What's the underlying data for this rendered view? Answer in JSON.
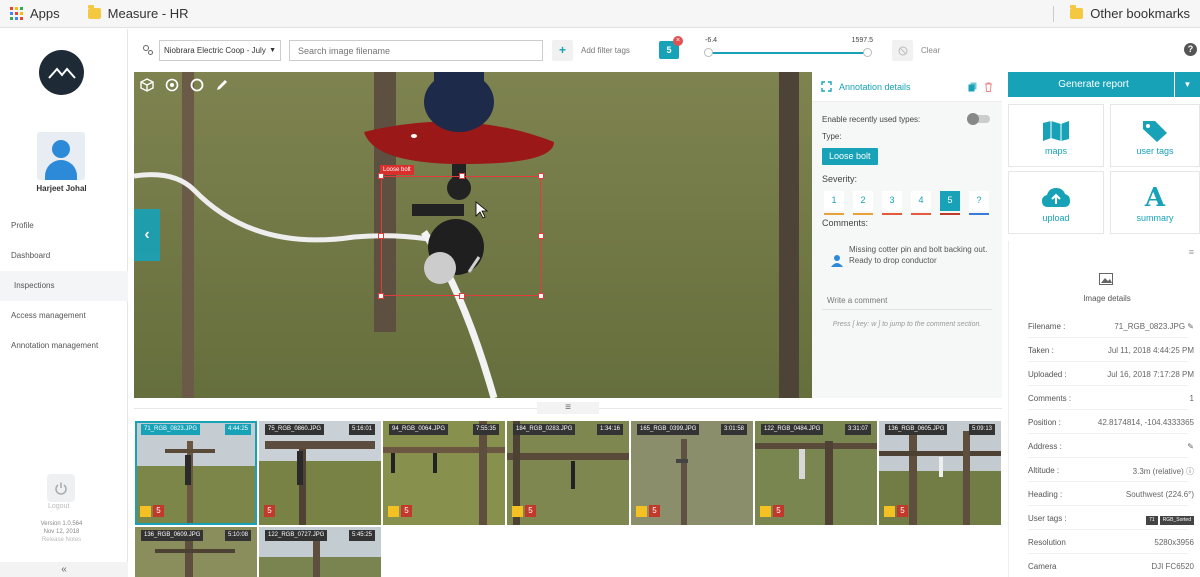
{
  "bookmarks": {
    "apps": "Apps",
    "folder1": "Measure - HR",
    "other": "Other bookmarks"
  },
  "sidebar": {
    "user_name": "Harjeet Johal",
    "nav": [
      {
        "label": "Profile"
      },
      {
        "label": "Dashboard"
      },
      {
        "label": "Inspections"
      },
      {
        "label": "Access management"
      },
      {
        "label": "Annotation management"
      }
    ],
    "logout": "Logout",
    "version": "Version 1.0.564",
    "version_date": "Nov 12, 2018",
    "release_notes": "Release Notes",
    "collapse": "«"
  },
  "toolbar": {
    "project": "Niobrara Electric Coop - July",
    "search_placeholder": "Search image filename",
    "add_filter": "Add filter tags",
    "filter_count": "5",
    "range_min": "-6.4",
    "range_max": "1597.5",
    "clear": "Clear",
    "help": "?"
  },
  "viewer": {
    "bbox_label": "Loose bolt"
  },
  "annotation": {
    "title": "Annotation details",
    "enable_recent": "Enable recently used types:",
    "type_label": "Type:",
    "type_value": "Loose bolt",
    "severity_label": "Severity:",
    "severity_levels": [
      "1",
      "2",
      "3",
      "4",
      "5",
      "?"
    ],
    "severity_selected": "5",
    "comments_label": "Comments:",
    "comment_text": "Missing cotter pin and bolt backing out. Ready to drop conductor",
    "write_placeholder": "Write a comment",
    "hint": "Press [ key: w ] to jump to the comment section."
  },
  "actions": {
    "generate_report": "Generate report",
    "tiles": [
      {
        "label": "maps",
        "icon": "map-icon"
      },
      {
        "label": "user tags",
        "icon": "tag-icon"
      },
      {
        "label": "upload",
        "icon": "cloud-upload-icon"
      },
      {
        "label": "summary",
        "icon": "letter-a-icon"
      }
    ]
  },
  "details": {
    "title": "Image details",
    "rows": [
      {
        "key": "Filename :",
        "value": "71_RGB_0823.JPG"
      },
      {
        "key": "Taken :",
        "value": "Jul 11, 2018 4:44:25 PM"
      },
      {
        "key": "Uploaded :",
        "value": "Jul 16, 2018 7:17:28 PM"
      },
      {
        "key": "Comments :",
        "value": "1"
      },
      {
        "key": "Position :",
        "value": "42.8174814, -104.4333365"
      },
      {
        "key": "Address :",
        "value": ""
      },
      {
        "key": "Altitude :",
        "value": "3.3m (relative)"
      },
      {
        "key": "Heading :",
        "value": "Southwest (224.6°)"
      },
      {
        "key": "User tags :",
        "value": ""
      },
      {
        "key": "Resolution",
        "value": "5280x3956"
      },
      {
        "key": "Camera",
        "value": "DJI FC6520"
      }
    ],
    "user_tags": [
      "71",
      "RGB_Sorted"
    ]
  },
  "thumbnails": [
    {
      "name": "71_RGB_0823.JPG",
      "time": "4:44:25",
      "severity": "5"
    },
    {
      "name": "75_RGB_0860.JPG",
      "time": "5:16:01",
      "severity": "5"
    },
    {
      "name": "94_RGB_0064.JPG",
      "time": "7:55:35",
      "severity": "5"
    },
    {
      "name": "184_RGB_0283.JPG",
      "time": "1:34:16",
      "severity": "5"
    },
    {
      "name": "165_RGB_0399.JPG",
      "time": "3:01:58",
      "severity": "5"
    },
    {
      "name": "122_RGB_0484.JPG",
      "time": "3:31:07",
      "severity": "5"
    },
    {
      "name": "136_RGB_0605.JPG",
      "time": "5:09:13",
      "severity": "5"
    },
    {
      "name": "136_RGB_0609.JPG",
      "time": "5:10:08",
      "severity": ""
    },
    {
      "name": "122_RGB_0727.JPG",
      "time": "5:45:25",
      "severity": ""
    }
  ],
  "colors": {
    "accent": "#17a2b8",
    "danger": "#c0392b",
    "tag": "#f5c021"
  }
}
